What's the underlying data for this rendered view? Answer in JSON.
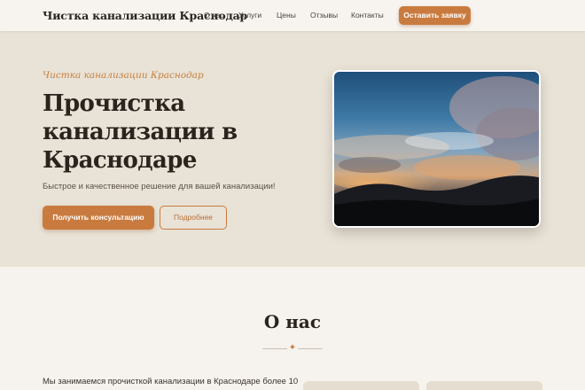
{
  "header": {
    "logo": "Чистка канализации Краснодар",
    "nav": [
      "О нас",
      "Услуги",
      "Цены",
      "Отзывы",
      "Контакты"
    ],
    "cta_label": "Оставить заявку"
  },
  "hero": {
    "tagline": "Чистка канализации Краснодар",
    "title_lines": [
      "Прочистка",
      "канализации в",
      "Краснодаре"
    ],
    "subtitle": "Быстрое и качественное решение для вашей канализации!",
    "primary_button": "Получить консультацию",
    "secondary_button": "Подробнее"
  },
  "about": {
    "title": "О нас",
    "divider_glyph": "✦",
    "text": "Мы занимаемся прочисткой канализации в Краснодаре более 10"
  },
  "colors": {
    "accent": "#c97b3f",
    "hero_background": "#e9e2d6",
    "page_background": "#f6f3ee"
  },
  "icons": {
    "divider": "ornament-star-icon"
  }
}
